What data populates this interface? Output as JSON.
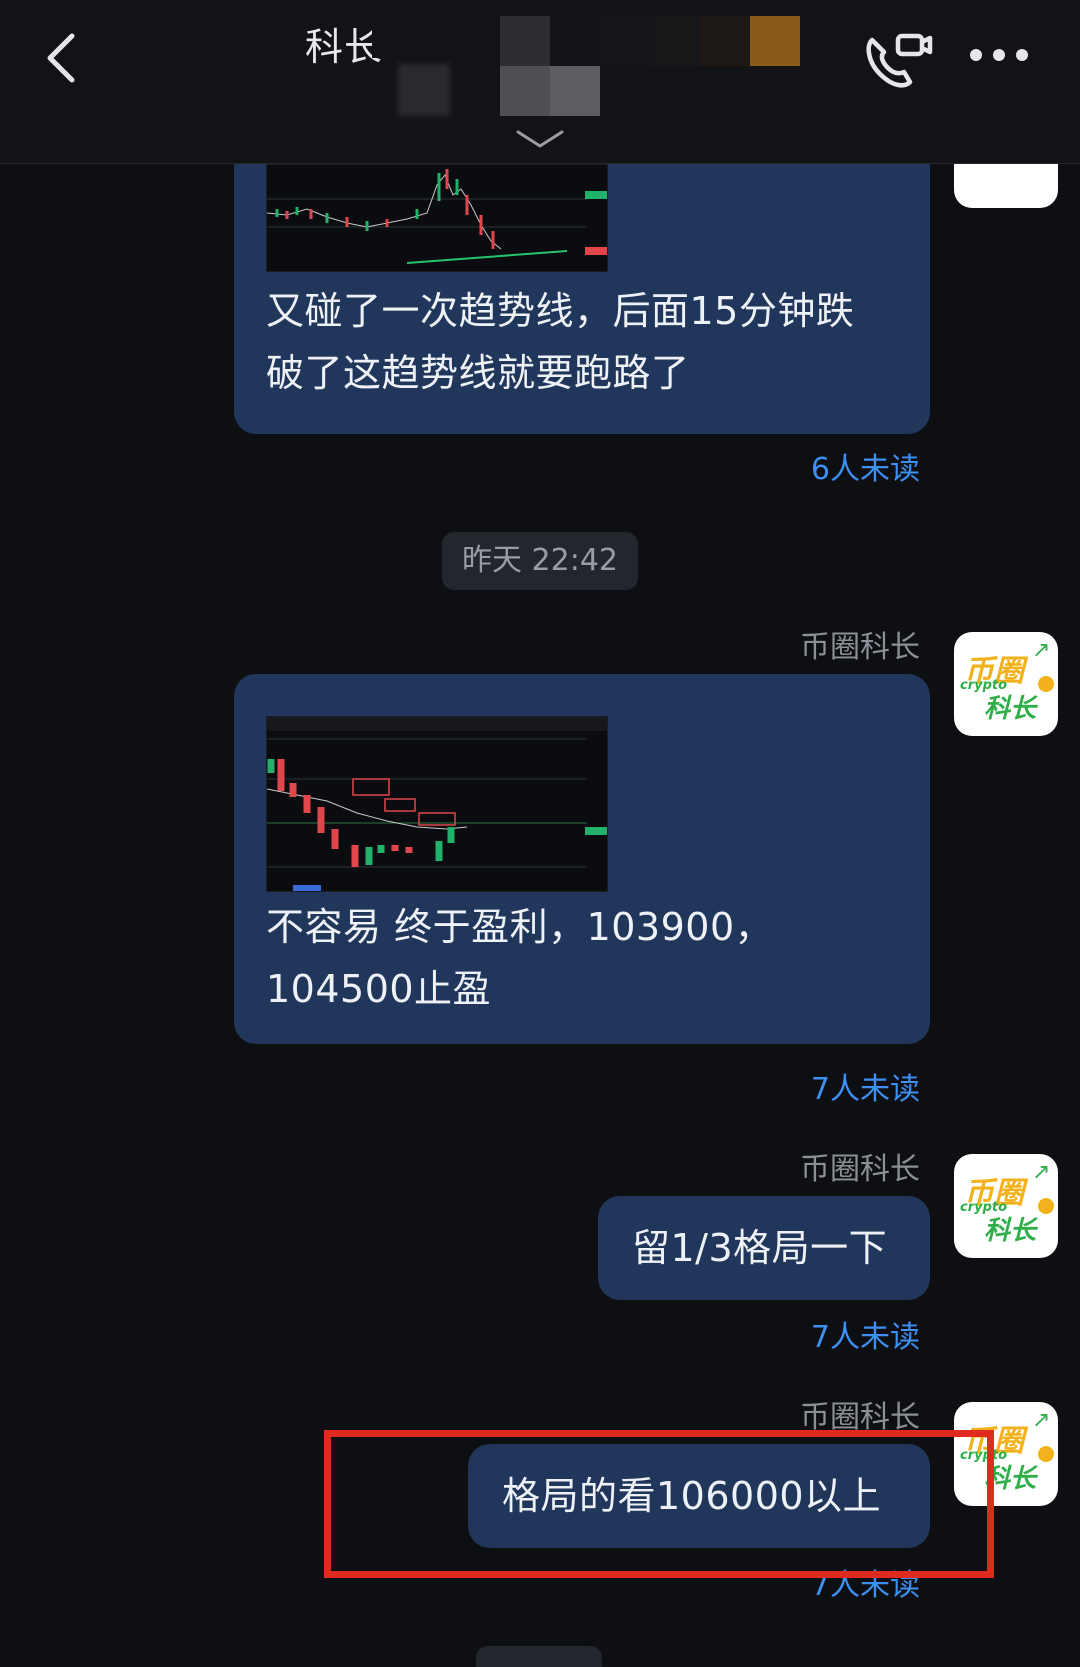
{
  "header": {
    "title": "科长",
    "back_icon": "chevron-left-icon",
    "call_icon": "video-call-icon",
    "more_icon": "more-dots-icon",
    "expand_icon": "chevron-down-icon"
  },
  "messages": [
    {
      "type": "image_text",
      "text_line1": "又碰了一次趋势线，后面15分钟跌",
      "text_line2": "破了这趋势线就要跑路了",
      "unread": "6人未读"
    },
    {
      "type": "timestamp",
      "time": "昨天 22:42"
    },
    {
      "type": "image_text",
      "sender": "币圈科长",
      "text_line1": "不容易 终于盈利，103900，",
      "text_line2": "104500止盈",
      "unread": "7人未读"
    },
    {
      "type": "text",
      "sender": "币圈科长",
      "text": "留1/3格局一下",
      "unread": "7人未读"
    },
    {
      "type": "text",
      "sender": "币圈科长",
      "text": "格局的看106000以上",
      "unread": "7人未读"
    }
  ],
  "avatar": {
    "line1": "币圈",
    "line2": "crypto",
    "line3": "科长"
  },
  "colors": {
    "bubble": "#20365a",
    "unread": "#3d8ff2",
    "highlight": "#e12a1f"
  }
}
